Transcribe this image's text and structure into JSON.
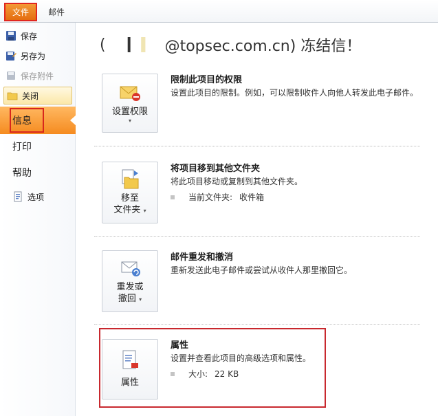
{
  "tabs": {
    "file": "文件",
    "mail": "邮件"
  },
  "sidebar": {
    "save": "保存",
    "save_as": "另存为",
    "save_attachments": "保存附件",
    "close": "关闭",
    "info": "信息",
    "print": "打印",
    "help": "帮助",
    "options": "选项"
  },
  "main": {
    "title_prefix": "(",
    "title_suffix": "@topsec.com.cn) 冻结信！",
    "sections": [
      {
        "button": [
          "设置权限"
        ],
        "title": "限制此项目的权限",
        "desc": "设置此项目的限制。例如，可以限制收件人向他人转发此电子邮件。"
      },
      {
        "button": [
          "移至",
          "文件夹"
        ],
        "title": "将项目移到其他文件夹",
        "desc": "将此项目移动或复制到其他文件夹。",
        "detail_label": "当前文件夹:",
        "detail_value": "收件箱"
      },
      {
        "button": [
          "重发或",
          "撤回"
        ],
        "title": "邮件重发和撤消",
        "desc": "重新发送此电子邮件或尝试从收件人那里撤回它。"
      },
      {
        "button": [
          "属性"
        ],
        "title": "属性",
        "desc": "设置并查看此项目的高级选项和属性。",
        "detail_label": "大小:",
        "detail_value": "22 KB"
      }
    ]
  },
  "colors": {
    "accent_orange": "#f58b20",
    "highlight_red": "#c8282e"
  }
}
